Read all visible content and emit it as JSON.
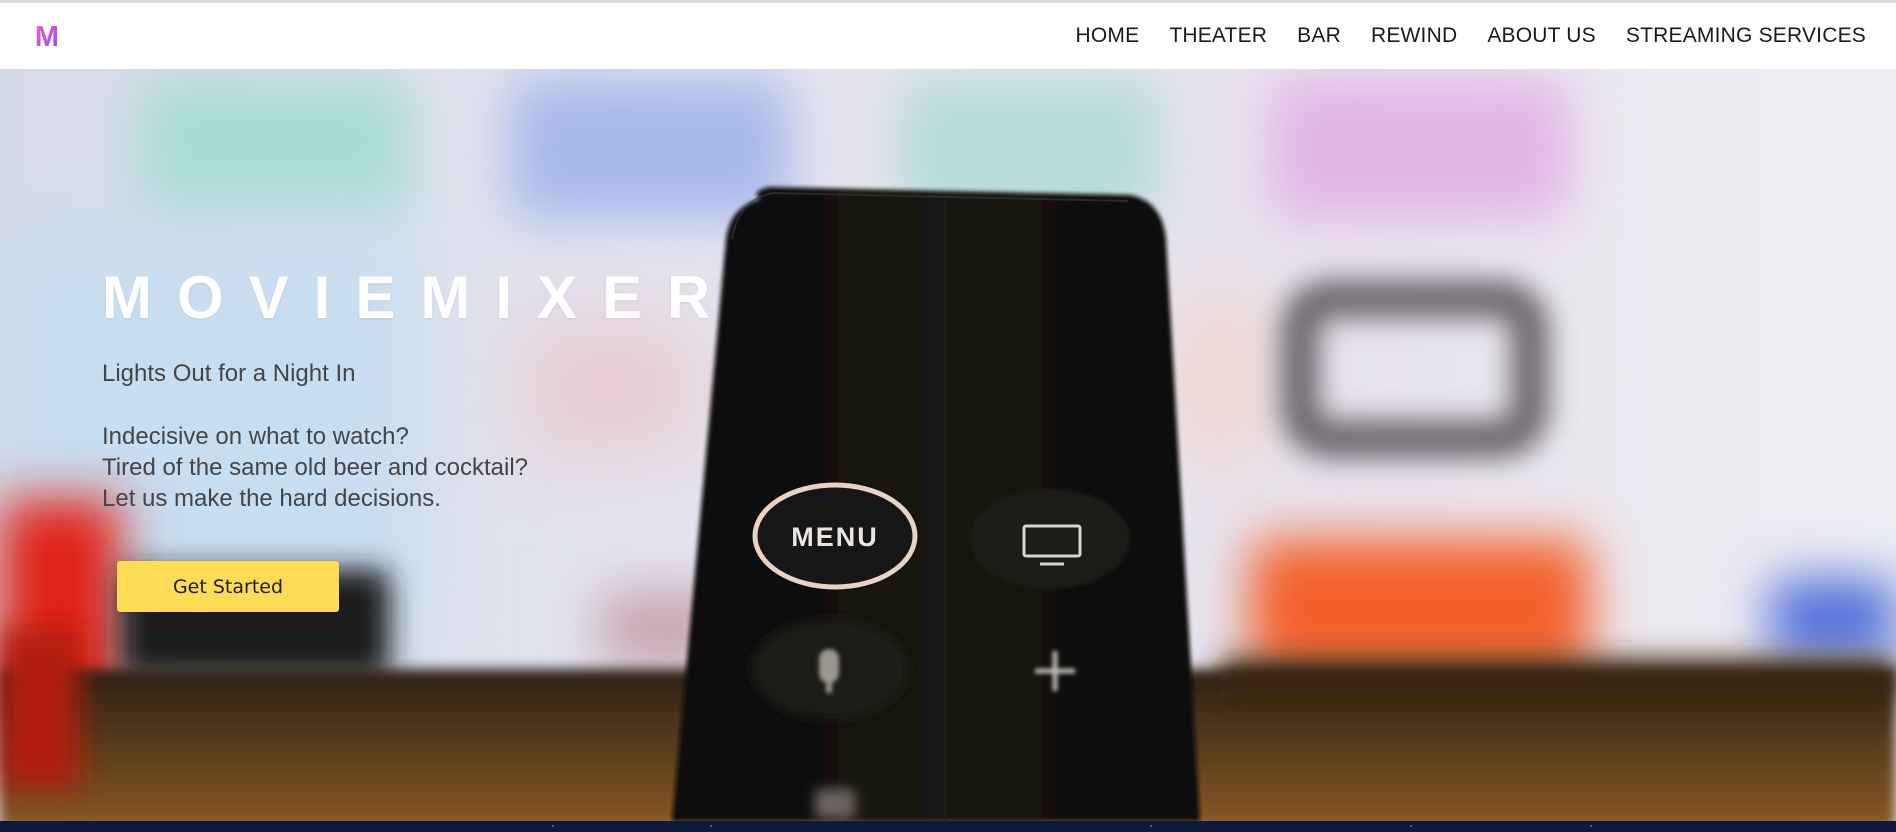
{
  "brand": {
    "logo_letter": "M",
    "logo_colors": [
      "#c64de0",
      "#f26bd1",
      "#8a5cf0"
    ]
  },
  "nav": {
    "items": [
      {
        "label": "HOME"
      },
      {
        "label": "THEATER"
      },
      {
        "label": "BAR"
      },
      {
        "label": "REWIND"
      },
      {
        "label": "ABOUT US"
      },
      {
        "label": "STREAMING SERVICES"
      }
    ]
  },
  "hero": {
    "title": "MOVIEMIXER",
    "tagline": "Lights Out for a Night In",
    "blurb_lines": [
      "Indecisive on what to watch?",
      "Tired of the same old beer and cocktail?",
      "Let us make the hard decisions."
    ],
    "cta_label": "Get Started",
    "cta_color": "#fedc56",
    "image": {
      "subject": "remote-control-icon",
      "remote_buttons": {
        "menu_label": "MENU",
        "tv_icon": "tv-icon",
        "mic_icon": "microphone-icon",
        "plus_icon": "plus-icon"
      }
    }
  },
  "footer_band_color": "#0d1a3b"
}
